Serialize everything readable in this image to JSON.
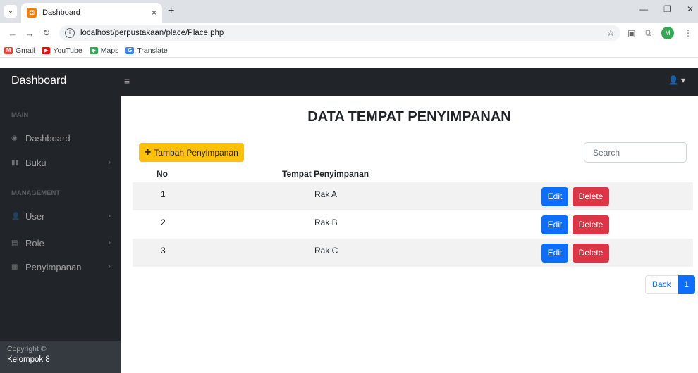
{
  "browser": {
    "tab_title": "Dashboard",
    "tab_close": "×",
    "new_tab": "+",
    "url": "localhost/perpustakaan/place/Place.php",
    "bookmarks": [
      "Gmail",
      "YouTube",
      "Maps",
      "Translate"
    ],
    "profile_initial": "M"
  },
  "topnav": {
    "brand": "Dashboard",
    "hamburger": "≡",
    "user_menu": "👤 ▾"
  },
  "sidebar": {
    "heading_main": "MAIN",
    "heading_management": "MANAGEMENT",
    "items": [
      {
        "label": "Dashboard",
        "icon": "dashboard-icon"
      },
      {
        "label": "Buku",
        "icon": "book-icon"
      },
      {
        "label": "User",
        "icon": "user-icon"
      },
      {
        "label": "Role",
        "icon": "id-card-icon"
      },
      {
        "label": "Penyimpanan",
        "icon": "storage-icon"
      }
    ],
    "footer_small": "Copyright ©",
    "footer_name": "Kelompok 8"
  },
  "main": {
    "title": "DATA TEMPAT PENYIMPANAN",
    "add_button": "Tambah Penyimpanan",
    "search_placeholder": "Search",
    "columns": [
      "No",
      "Tempat Penyimpanan"
    ],
    "rows": [
      {
        "no": "1",
        "name": "Rak A"
      },
      {
        "no": "2",
        "name": "Rak B"
      },
      {
        "no": "3",
        "name": "Rak C"
      }
    ],
    "edit_label": "Edit",
    "delete_label": "Delete",
    "pagination_back": "Back",
    "pagination_page": "1"
  },
  "colors": {
    "dark": "#212529",
    "warning": "#ffc107",
    "primary": "#0d6efd",
    "danger": "#dc3545"
  }
}
